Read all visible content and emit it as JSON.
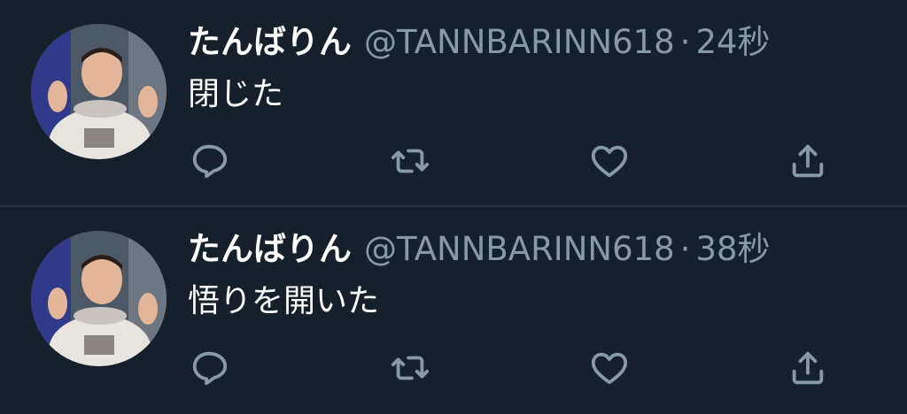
{
  "tweets": [
    {
      "display_name": "たんばりん",
      "handle": "@TANNBARINN618",
      "separator": "·",
      "time": "24秒",
      "text": "閉じた",
      "avatar_icon": "user-avatar-photo",
      "actions": [
        "reply-icon",
        "retweet-icon",
        "like-icon",
        "share-icon"
      ]
    },
    {
      "display_name": "たんばりん",
      "handle": "@TANNBARINN618",
      "separator": "·",
      "time": "38秒",
      "text": "悟りを開いた",
      "avatar_icon": "user-avatar-photo",
      "actions": [
        "reply-icon",
        "retweet-icon",
        "like-icon",
        "share-icon"
      ]
    }
  ],
  "colors": {
    "background": "#15202b",
    "primary_text": "#ffffff",
    "secondary_text": "#8899a6",
    "divider": "#253341"
  }
}
